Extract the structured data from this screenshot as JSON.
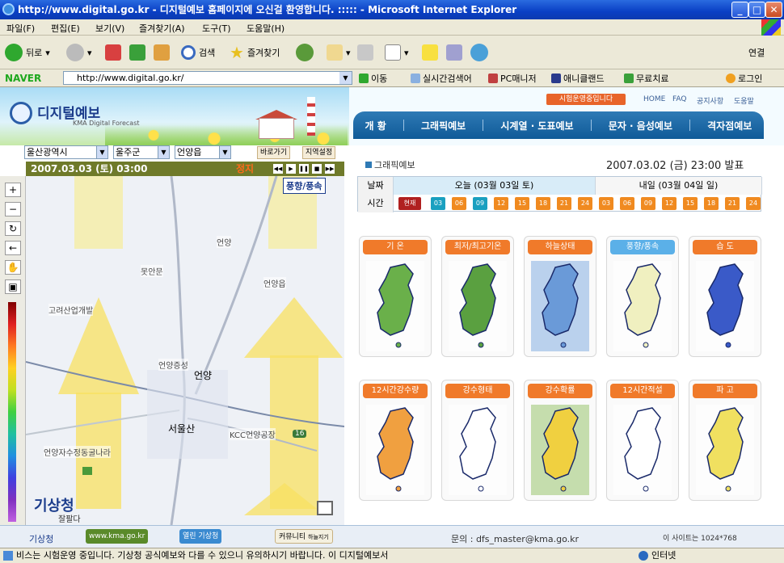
{
  "window": {
    "title": "http://www.digital.go.kr - 디지털예보 홈페이지에 오신걸 환영합니다. ::::: - Microsoft Internet Explorer",
    "min": "_",
    "max": "□",
    "close": "✕"
  },
  "menu": [
    "파일(F)",
    "편집(E)",
    "보기(V)",
    "즐겨찾기(A)",
    "도구(T)",
    "도움말(H)"
  ],
  "toolbar": {
    "back": "뒤로",
    "search": "검색",
    "favorites": "즐겨찾기",
    "links": "연결"
  },
  "addressbar": {
    "brand": "NAVER",
    "url": "http://www.digital.go.kr/",
    "go": "이동",
    "realtime": "실시간검색어",
    "pc": "PC매니저",
    "any": "애니클랜드",
    "free": "무료치료",
    "login": "로그인"
  },
  "header": {
    "logo": "디지털예보",
    "logo_sub": "KMA Digital Forecast",
    "notice": "시험운영중입니다",
    "links": [
      "HOME",
      "FAQ",
      "공지사항",
      "도움말"
    ]
  },
  "nav": [
    "개 황",
    "그래픽예보",
    "시계열 · 도표예보",
    "문자 · 음성예보",
    "격자점예보"
  ],
  "region": {
    "sido": "울산광역시",
    "gu": "울주군",
    "dong": "언양읍",
    "btn_go": "바로가기",
    "btn_set": "지역설정"
  },
  "map": {
    "datetime": "2007.03.03 (토) 03:00",
    "stop": "정지",
    "wind_label": "풍향/풍속",
    "kma": "기상청",
    "kma_sub": "잘팔다",
    "places": [
      "언양",
      "못안문",
      "언양읍",
      "고려산업개발",
      "언양증성",
      "언양",
      "서울산",
      "KCC언양공장",
      "언양자수정동굴나라"
    ],
    "road": "16"
  },
  "tools": [
    "+",
    "−",
    "↻",
    "←",
    "✋",
    "▣"
  ],
  "panel": {
    "section": "그래픽예보",
    "issue": "2007.03.02 (금) 23:00 발표",
    "date_label": "날짜",
    "time_label": "시간",
    "today": "오늘 (03월 03일 토)",
    "tomorrow": "내일 (03월 04일 일)",
    "now": "현재",
    "times": [
      "03",
      "06",
      "09",
      "12",
      "15",
      "18",
      "21",
      "24",
      "03",
      "06",
      "09",
      "12",
      "15",
      "18",
      "21",
      "24"
    ]
  },
  "cards": [
    {
      "label": "기 온",
      "active": false
    },
    {
      "label": "최저/최고기온",
      "active": false
    },
    {
      "label": "하늘상태",
      "active": false
    },
    {
      "label": "풍향/풍속",
      "active": true
    },
    {
      "label": "습 도",
      "active": false
    },
    {
      "label": "12시간강수량",
      "active": false
    },
    {
      "label": "강수형태",
      "active": false
    },
    {
      "label": "강수확률",
      "active": false
    },
    {
      "label": "12시간적설",
      "active": false
    },
    {
      "label": "파 고",
      "active": false
    }
  ],
  "footer": {
    "kma": "www.kma.go.kr",
    "open": "열린 기상청",
    "community": "커뮤니티",
    "community_sub": "하늘지기",
    "contact": "문의 : dfs_master@kma.go.kr",
    "resolution": "이 사이트는 1024*768",
    "left_logo": "기상청"
  },
  "status": {
    "text": "비스는 시험운영 중입니다. 기상청 공식예보와 다를 수 있으니 유의하시기 바랍니다.   이 디지털예보서",
    "zone": "인터넷"
  }
}
